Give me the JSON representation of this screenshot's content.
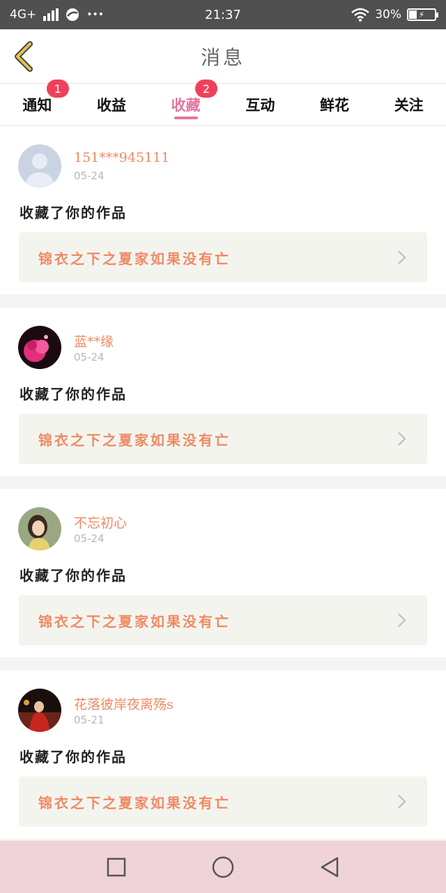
{
  "status_bar": {
    "network": "4G+",
    "dots": "•••",
    "time": "21:37",
    "battery": "30%"
  },
  "header": {
    "title": "消息",
    "accent_color": "#e8c24a"
  },
  "tabs": [
    {
      "label": "通知",
      "badge": "1"
    },
    {
      "label": "收益",
      "badge": ""
    },
    {
      "label": "收藏",
      "badge": "2",
      "active": true
    },
    {
      "label": "互动",
      "badge": ""
    },
    {
      "label": "鲜花",
      "badge": ""
    },
    {
      "label": "关注",
      "badge": ""
    }
  ],
  "items": [
    {
      "username": "151***945111",
      "date": "05-24",
      "action": "收藏了你的作品",
      "work_title": "锦衣之下之夏家如果没有亡",
      "avatar": "default-avatar"
    },
    {
      "username": "蓝**缘",
      "date": "05-24",
      "action": "收藏了你的作品",
      "work_title": "锦衣之下之夏家如果没有亡",
      "avatar": "pink-flower-avatar"
    },
    {
      "username": "不忘初心",
      "date": "05-24",
      "action": "收藏了你的作品",
      "work_title": "锦衣之下之夏家如果没有亡",
      "avatar": "woman-photo-avatar"
    },
    {
      "username": "花落彼岸夜离殇s",
      "date": "05-21",
      "action": "收藏了你的作品",
      "work_title": "锦衣之下之夏家如果没有亡",
      "avatar": "red-costume-avatar"
    }
  ],
  "colors": {
    "accent_pink": "#e2779f",
    "badge_red": "#f0415a",
    "username_orange": "#ef8a62",
    "navbar_bg": "#efd3d8"
  }
}
